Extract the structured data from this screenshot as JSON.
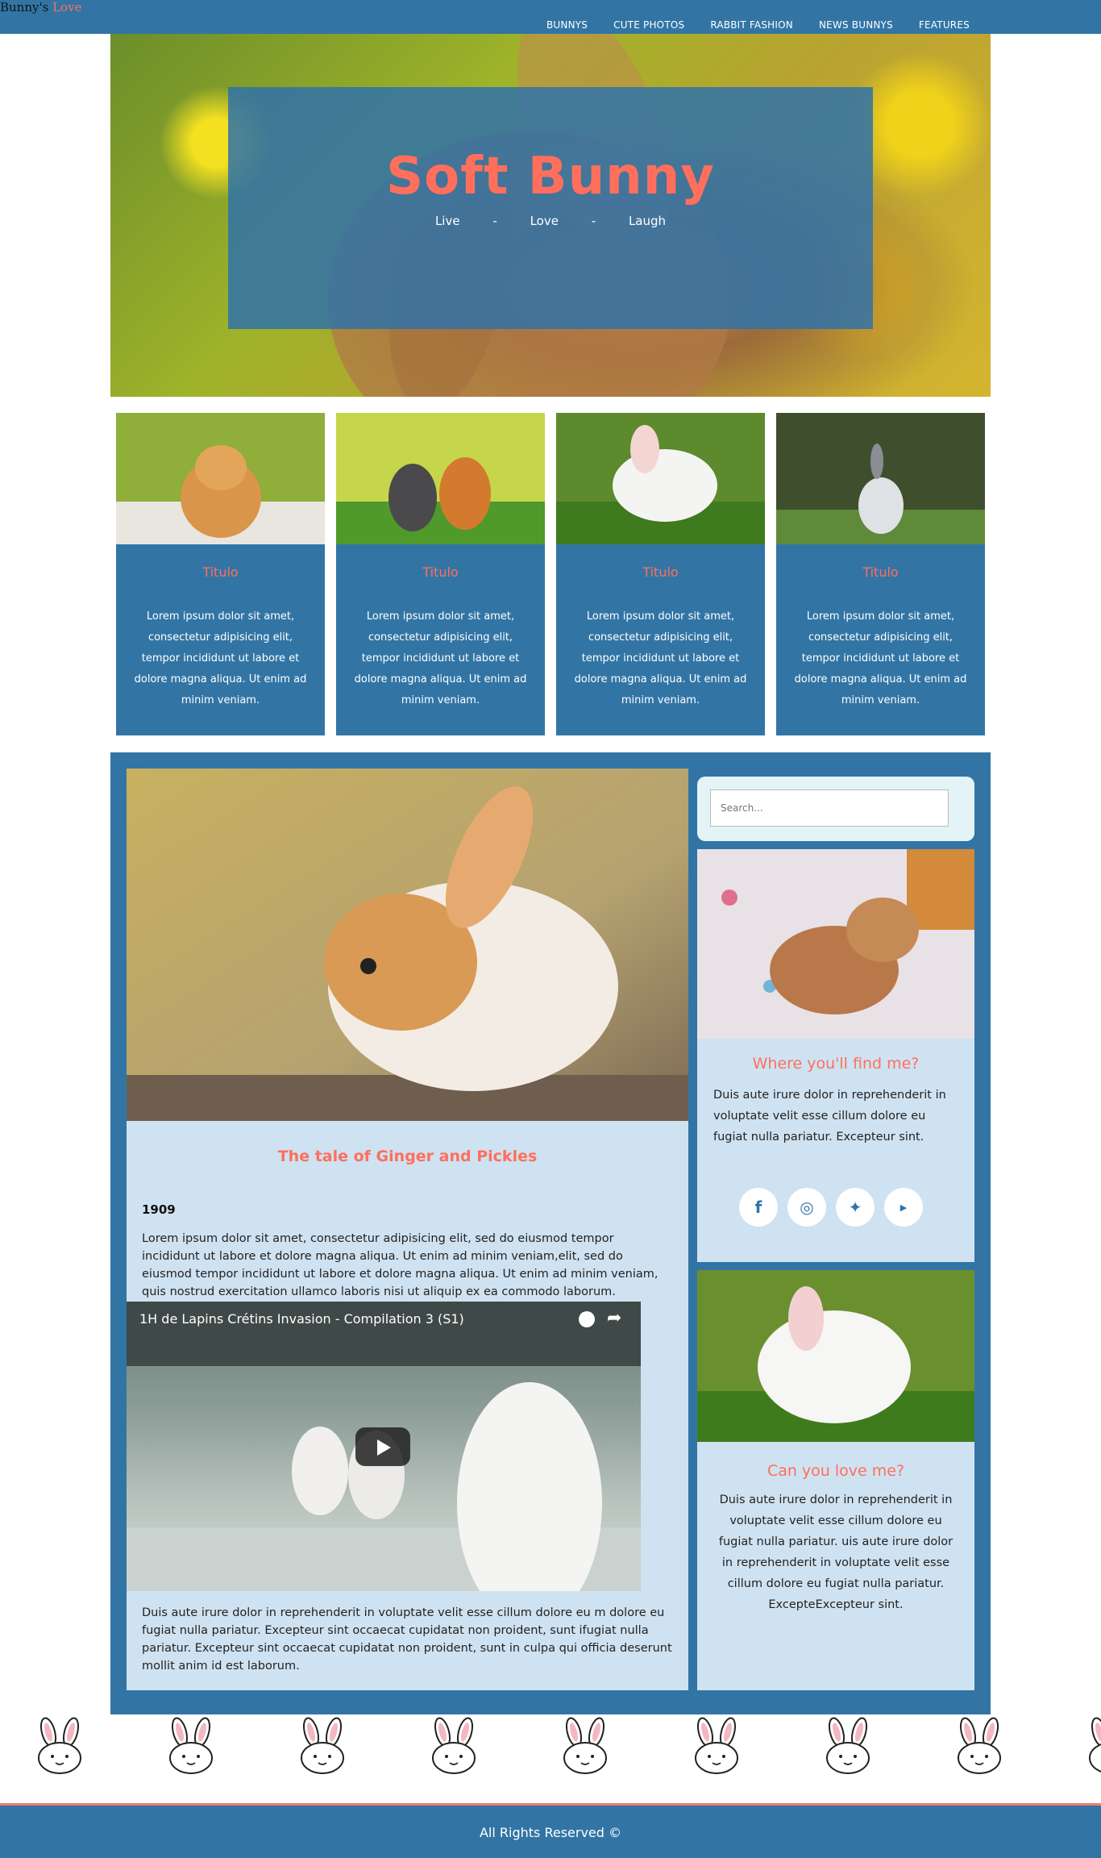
{
  "brand": {
    "name": "Bunny's",
    "accent": "Love",
    "accent_color": "#ff6f5c"
  },
  "nav": {
    "items": [
      "BUNNYS",
      "CUTE PHOTOS",
      "RABBIT FASHION",
      "NEWS BUNNYS",
      "FEATURES"
    ]
  },
  "hero": {
    "title": "Soft Bunny",
    "tagline": [
      "Live",
      "-",
      "Love",
      "-",
      "Laugh"
    ]
  },
  "cards": [
    {
      "title": "Titulo",
      "text": "Lorem ipsum dolor sit amet, consectetur adipisicing elit, tempor incididunt ut labore et dolore magna aliqua. Ut enim ad minim veniam."
    },
    {
      "title": "Titulo",
      "text": "Lorem ipsum dolor sit amet, consectetur adipisicing elit, tempor incididunt ut labore et dolore magna aliqua. Ut enim ad minim veniam."
    },
    {
      "title": "Titulo",
      "text": "Lorem ipsum dolor sit amet, consectetur adipisicing elit, tempor incididunt ut labore et dolore magna aliqua. Ut enim ad minim veniam."
    },
    {
      "title": "Titulo",
      "text": "Lorem ipsum dolor sit amet, consectetur adipisicing elit, tempor incididunt ut labore et dolore magna aliqua. Ut enim ad minim veniam."
    }
  ],
  "article": {
    "title": "The tale of Ginger and Pickles",
    "year": "1909",
    "paragraph1": "Lorem ipsum dolor sit amet, consectetur adipisicing elit, sed do eiusmod tempor incididunt ut labore et dolore magna aliqua. Ut enim ad minim veniam,elit, sed do eiusmod tempor incididunt ut labore et dolore magna aliqua. Ut enim ad minim veniam, quis nostrud exercitation ullamco laboris nisi ut aliquip ex ea commodo laborum.",
    "video_title": "1H de Lapins Crétins Invasion - Compilation 3 (S1)",
    "paragraph2": "Duis aute irure dolor in reprehenderit in voluptate velit esse cillum dolore eu m dolore eu fugiat nulla pariatur. Excepteur sint occaecat cupidatat non proident, sunt ifugiat nulla pariatur. Excepteur sint occaecat cupidatat non proident, sunt in culpa qui officia deserunt mollit anim id est laborum."
  },
  "sidebar": {
    "search_placeholder": "Search...",
    "box1": {
      "title": "Where you'll find me?",
      "text": "Duis aute irure dolor in reprehenderit in voluptate velit esse cillum dolore eu fugiat nulla pariatur. Excepteur sint."
    },
    "socials": [
      "facebook-icon",
      "instagram-icon",
      "twitter-icon",
      "youtube-icon"
    ],
    "box2": {
      "title": "Can you love me?",
      "text": "Duis aute irure dolor in reprehenderit in voluptate velit esse cillum dolore eu fugiat nulla pariatur. uis aute irure dolor in reprehenderit in voluptate velit esse cillum dolore eu fugiat nulla pariatur. ExcepteExcepteur sint."
    }
  },
  "footer": {
    "text": "All Rights Reserved ©"
  },
  "colors": {
    "primary": "#3275a5",
    "accent": "#ff6f5c",
    "panel": "#cfe2f1",
    "footer_line": "#f17b6c"
  }
}
